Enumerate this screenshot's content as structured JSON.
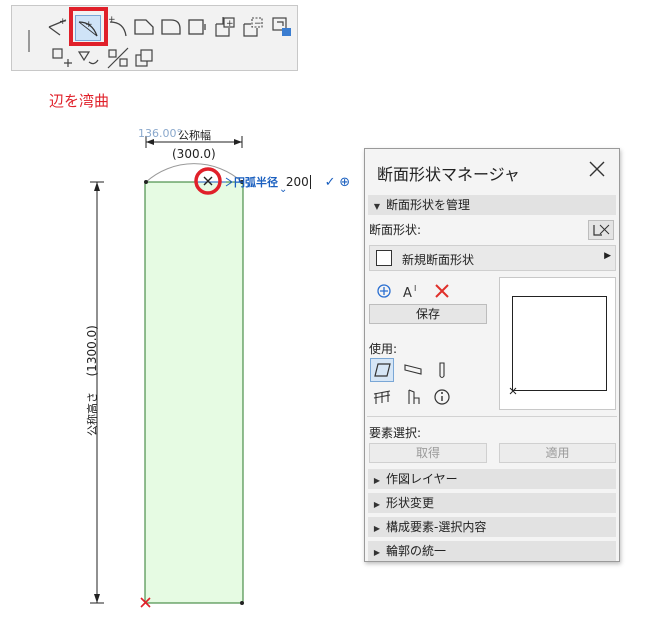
{
  "caption": "辺を湾曲",
  "drawing": {
    "arc_angle": "136.00°",
    "width_label": "公称幅",
    "width_value": "(300.0)",
    "height_label": "公称高さ",
    "height_value": "(1300.0)",
    "tracker_label": "円弧半径",
    "tracker_value": "200",
    "colors": {
      "fill": "#e6fbe3",
      "outline": "#2a7a2a",
      "highlight": "#e0202a",
      "tracker": "#1a5fbf"
    }
  },
  "dialog": {
    "title": "断面形状マネージャ",
    "manage_section": "断面形状を管理",
    "profile_label": "断面形状:",
    "profile_dropdown": "新規断面形状",
    "save_button": "保存",
    "usage_label": "使用:",
    "element_selection_label": "要素選択:",
    "get_button": "取得",
    "apply_button": "適用",
    "sections": [
      "作図レイヤー",
      "形状変更",
      "構成要素-選択内容",
      "輪郭の統一"
    ]
  }
}
